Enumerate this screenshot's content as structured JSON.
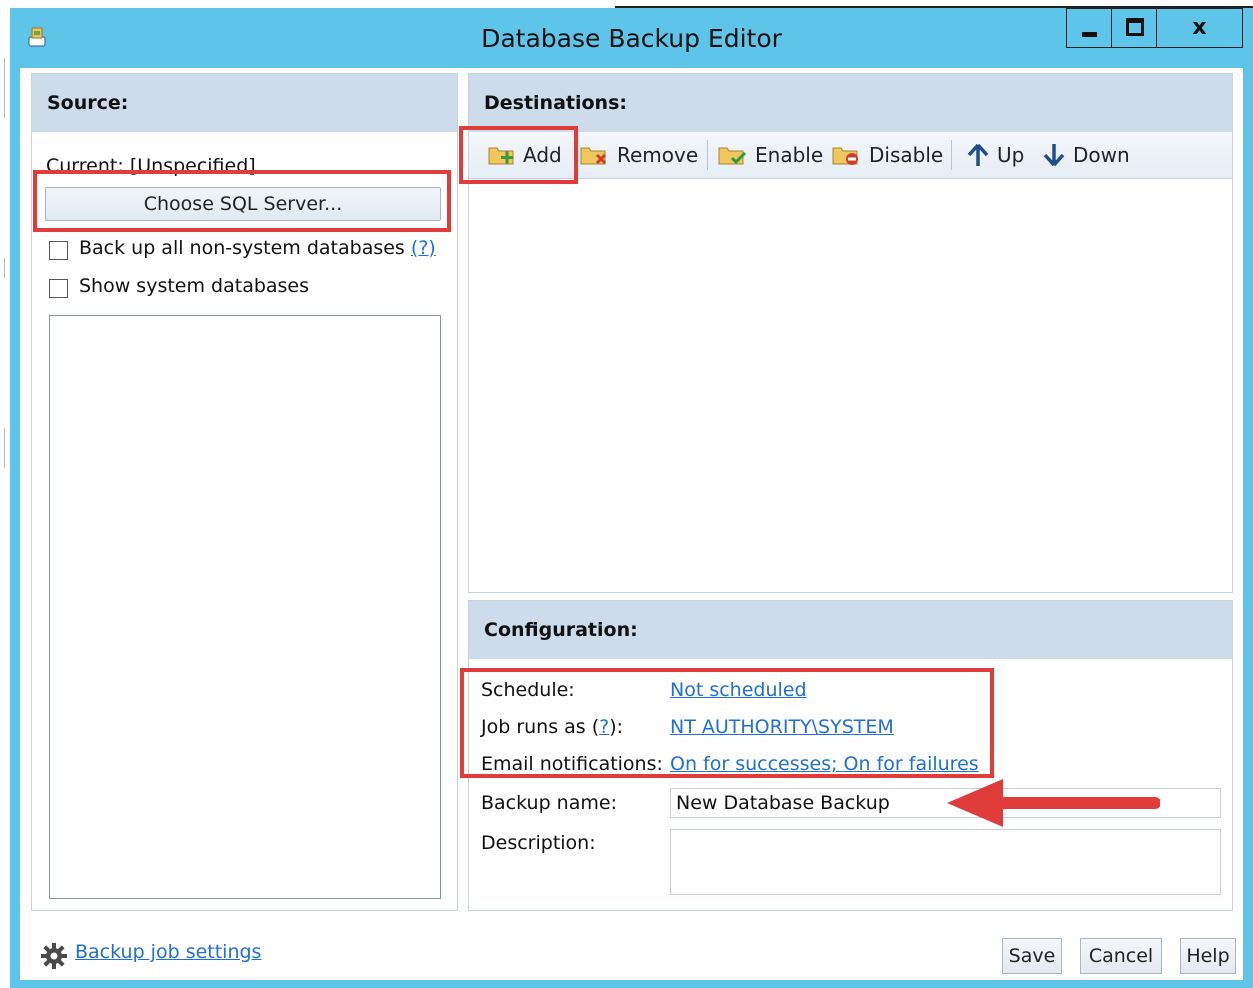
{
  "window": {
    "title": "Database Backup Editor",
    "close_glyph": "x",
    "icons": [
      "app-icon",
      "minimize-icon",
      "maximize-icon",
      "close-icon"
    ]
  },
  "source": {
    "header": "Source:",
    "current_label": "Current:",
    "current_value": "[Unspecified]",
    "choose_button": "Choose SQL Server...",
    "backup_all_label": "Back up all non-system databases",
    "help_glyph": "?",
    "show_system_label": "Show system databases",
    "backup_all_checked": false,
    "show_system_checked": false
  },
  "destinations": {
    "header": "Destinations:",
    "toolbar": {
      "add": "Add",
      "remove": "Remove",
      "enable": "Enable",
      "disable": "Disable",
      "up": "Up",
      "down": "Down"
    }
  },
  "configuration": {
    "header": "Configuration:",
    "schedule_label": "Schedule:",
    "schedule_value": "Not scheduled",
    "job_runs_as_label_pre": "Job runs as (",
    "job_runs_as_help": "?",
    "job_runs_as_label_post": "):",
    "job_runs_as_value": "NT AUTHORITY\\SYSTEM",
    "email_label": "Email notifications:",
    "email_value": "On for successes; On for failures",
    "backup_name_label": "Backup name:",
    "backup_name_value": "New Database Backup",
    "description_label": "Description:",
    "description_value": ""
  },
  "footer": {
    "settings_link": "Backup job settings",
    "save": "Save",
    "cancel": "Cancel",
    "help": "Help"
  },
  "colors": {
    "title_bar": "#5ec4e8",
    "panel_header": "#cddbeb",
    "link": "#1f6fd6",
    "highlight": "#e03c3c"
  }
}
